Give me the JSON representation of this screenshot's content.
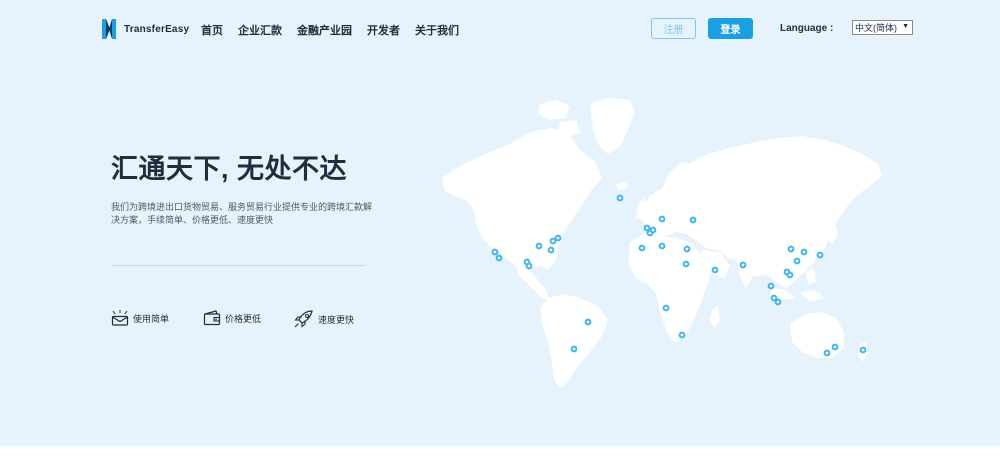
{
  "header": {
    "logo_text": "TransferEasy",
    "nav": [
      "首页",
      "企业汇款",
      "金融产业园",
      "开发者",
      "关于我们"
    ],
    "register_label": "注册",
    "login_label": "登录",
    "language_label": "Language :",
    "language_selected": "中文(简体)"
  },
  "hero": {
    "title": "汇通天下, 无处不达",
    "description": "我们为跨境进出口货物贸易、服务贸易行业提供专业的跨境汇款解决方案，手续简单、价格更低、速度更快",
    "features": [
      {
        "label": "使用简单",
        "icon": "envelope-tray-icon"
      },
      {
        "label": "价格更低",
        "icon": "wallet-icon"
      },
      {
        "label": "速度更快",
        "icon": "rocket-icon"
      }
    ]
  },
  "colors": {
    "hero_background": "#e6f3fc",
    "accent": "#1a9fe3",
    "map_land": "#ffffff",
    "map_marker": "#3fb6ef"
  }
}
